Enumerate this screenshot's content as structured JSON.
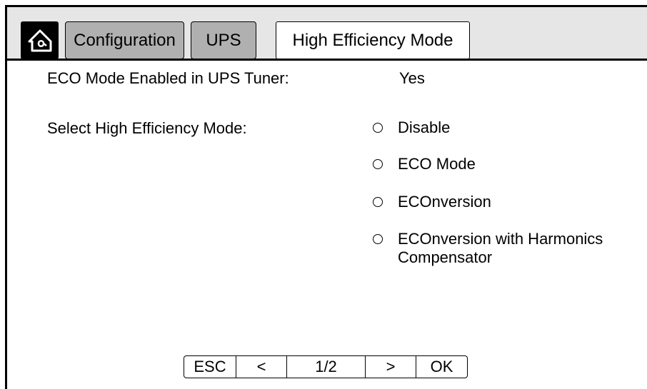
{
  "header": {
    "home_icon": "home-icon",
    "breadcrumbs": [
      {
        "label": "Configuration"
      },
      {
        "label": "UPS"
      },
      {
        "label": "High Efficiency Mode"
      }
    ]
  },
  "main": {
    "eco_tuner_label": "ECO Mode Enabled in UPS Tuner:",
    "eco_tuner_value": "Yes",
    "select_mode_label": "Select High Efficiency Mode:",
    "options": [
      {
        "label": "Disable"
      },
      {
        "label": "ECO Mode"
      },
      {
        "label": "ECOnversion"
      },
      {
        "label": "ECOnversion with Harmonics Compensator"
      }
    ]
  },
  "footer": {
    "esc_label": "ESC",
    "prev_label": "<",
    "page_label": "1/2",
    "next_label": ">",
    "ok_label": "OK"
  }
}
